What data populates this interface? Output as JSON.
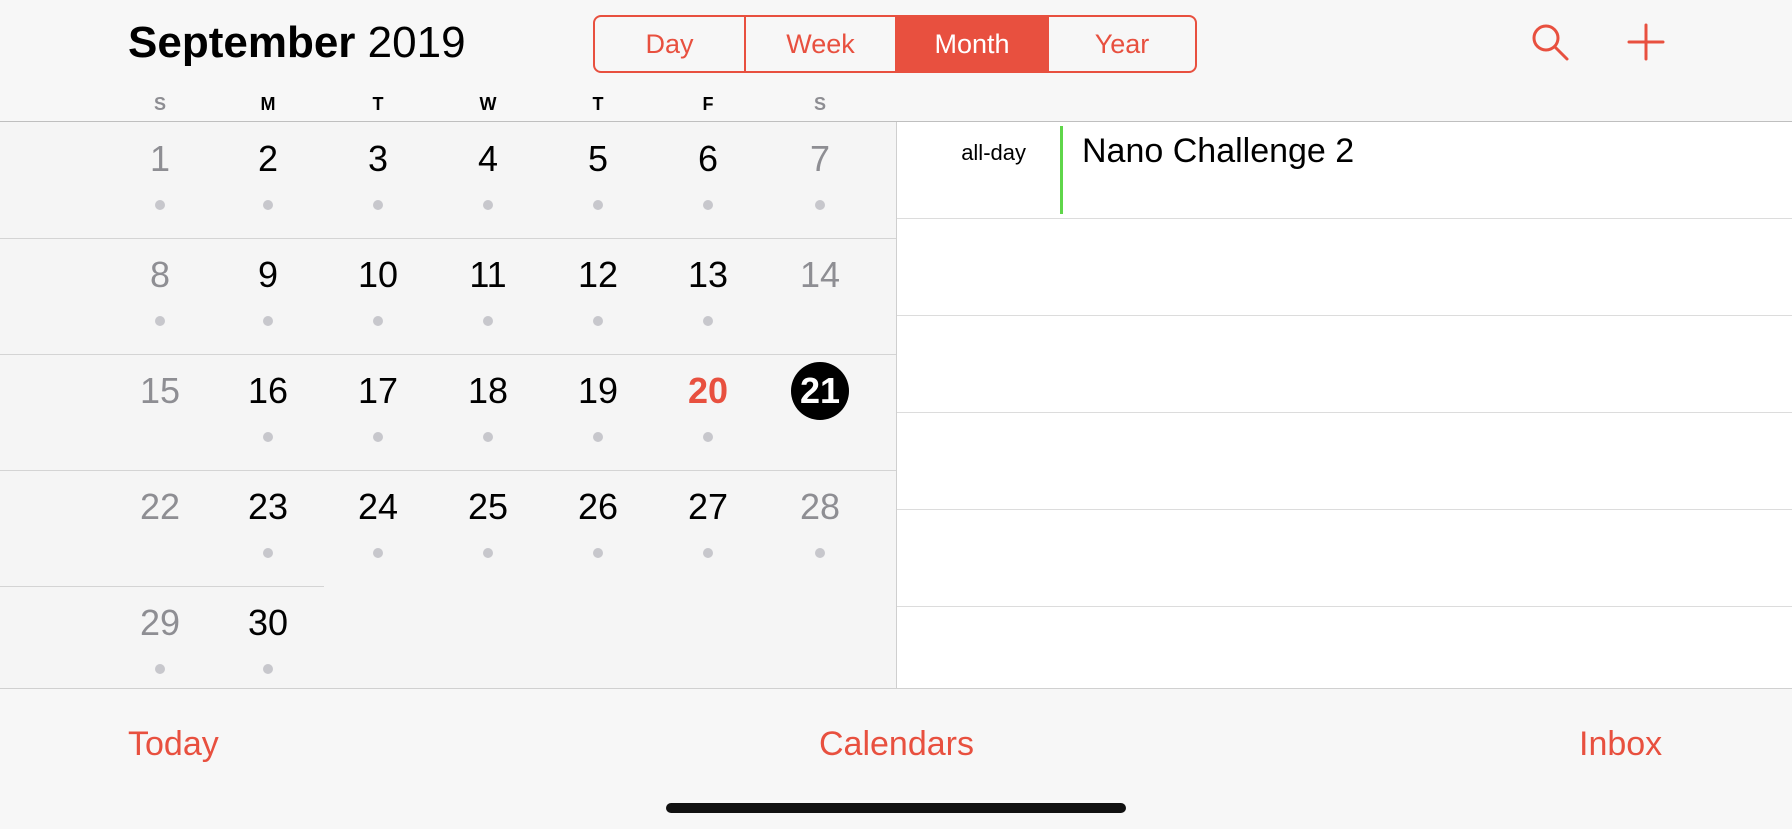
{
  "header": {
    "month": "September",
    "year": "2019",
    "tabs": [
      {
        "label": "Day",
        "active": false
      },
      {
        "label": "Week",
        "active": false
      },
      {
        "label": "Month",
        "active": true
      },
      {
        "label": "Year",
        "active": false
      }
    ],
    "icons": [
      "search-icon",
      "add-icon"
    ]
  },
  "weekdays": [
    "S",
    "M",
    "T",
    "W",
    "T",
    "F",
    "S"
  ],
  "calendar": {
    "weeks": [
      [
        {
          "d": "1",
          "dot": true
        },
        {
          "d": "2",
          "dot": true
        },
        {
          "d": "3",
          "dot": true
        },
        {
          "d": "4",
          "dot": true
        },
        {
          "d": "5",
          "dot": true
        },
        {
          "d": "6",
          "dot": true
        },
        {
          "d": "7",
          "dot": true
        }
      ],
      [
        {
          "d": "8",
          "dot": true
        },
        {
          "d": "9",
          "dot": true
        },
        {
          "d": "10",
          "dot": true
        },
        {
          "d": "11",
          "dot": true
        },
        {
          "d": "12",
          "dot": true
        },
        {
          "d": "13",
          "dot": true
        },
        {
          "d": "14",
          "dot": false
        }
      ],
      [
        {
          "d": "15",
          "dot": false
        },
        {
          "d": "16",
          "dot": true
        },
        {
          "d": "17",
          "dot": true
        },
        {
          "d": "18",
          "dot": true
        },
        {
          "d": "19",
          "dot": true
        },
        {
          "d": "20",
          "dot": true,
          "today": true
        },
        {
          "d": "21",
          "dot": false,
          "selected": true
        }
      ],
      [
        {
          "d": "22",
          "dot": false
        },
        {
          "d": "23",
          "dot": true
        },
        {
          "d": "24",
          "dot": true
        },
        {
          "d": "25",
          "dot": true
        },
        {
          "d": "26",
          "dot": true
        },
        {
          "d": "27",
          "dot": true
        },
        {
          "d": "28",
          "dot": true
        }
      ],
      [
        {
          "d": "29",
          "dot": true
        },
        {
          "d": "30",
          "dot": true
        }
      ]
    ]
  },
  "events": {
    "allday_label": "all-day",
    "items": [
      {
        "title": "Nano Challenge 2",
        "color": "#5fd64a"
      }
    ]
  },
  "footer": {
    "today": "Today",
    "calendars": "Calendars",
    "inbox": "Inbox"
  },
  "colors": {
    "accent": "#e8503f",
    "selected": "#000000",
    "dot": "#c7c7cc"
  }
}
